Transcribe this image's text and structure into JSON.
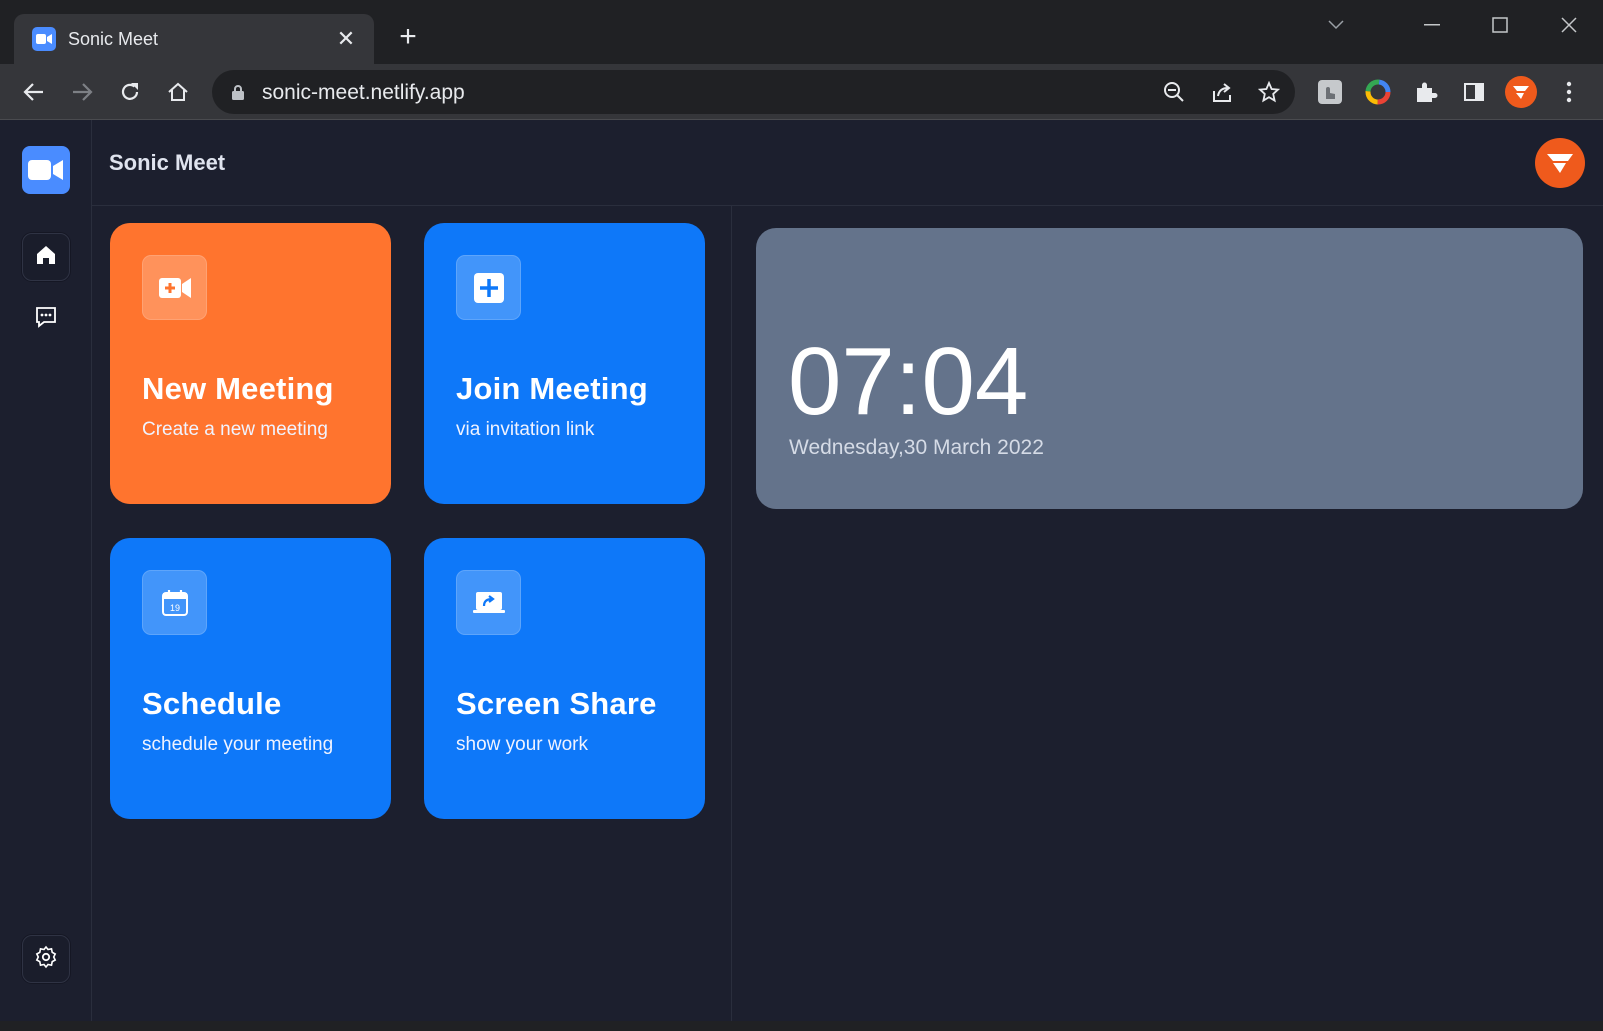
{
  "browser": {
    "tab_title": "Sonic Meet",
    "url": "sonic-meet.netlify.app",
    "icons": [
      "back-icon",
      "forward-icon",
      "reload-icon",
      "home-icon",
      "lock-icon",
      "zoom-out-icon",
      "share-icon",
      "star-icon",
      "extension-icon",
      "color-picker-icon",
      "puzzle-icon",
      "side-panel-icon",
      "profile-icon",
      "menu-icon"
    ]
  },
  "app": {
    "title": "Sonic Meet",
    "sidebar": {
      "items": [
        "logo-icon",
        "home-icon",
        "chat-icon",
        "settings-icon"
      ]
    },
    "cards": [
      {
        "title": "New Meeting",
        "subtitle": "Create a new meeting",
        "icon": "video-add-icon",
        "color": "#ff742e"
      },
      {
        "title": "Join Meeting",
        "subtitle": "via invitation link",
        "icon": "plus-box-icon",
        "color": "#0e78f9"
      },
      {
        "title": "Schedule",
        "subtitle": "schedule your meeting",
        "icon": "calendar-icon",
        "color": "#0e78f9"
      },
      {
        "title": "Screen Share",
        "subtitle": "show your work",
        "icon": "screen-share-icon",
        "color": "#0e78f9"
      }
    ],
    "calendar_day": "19",
    "clock": {
      "time": "07:04",
      "date": "Wednesday,30 March 2022"
    }
  },
  "colors": {
    "background": "#1c1f2e",
    "accent_orange": "#ff742e",
    "accent_blue": "#0e78f9",
    "clock_card": "#64738b"
  }
}
